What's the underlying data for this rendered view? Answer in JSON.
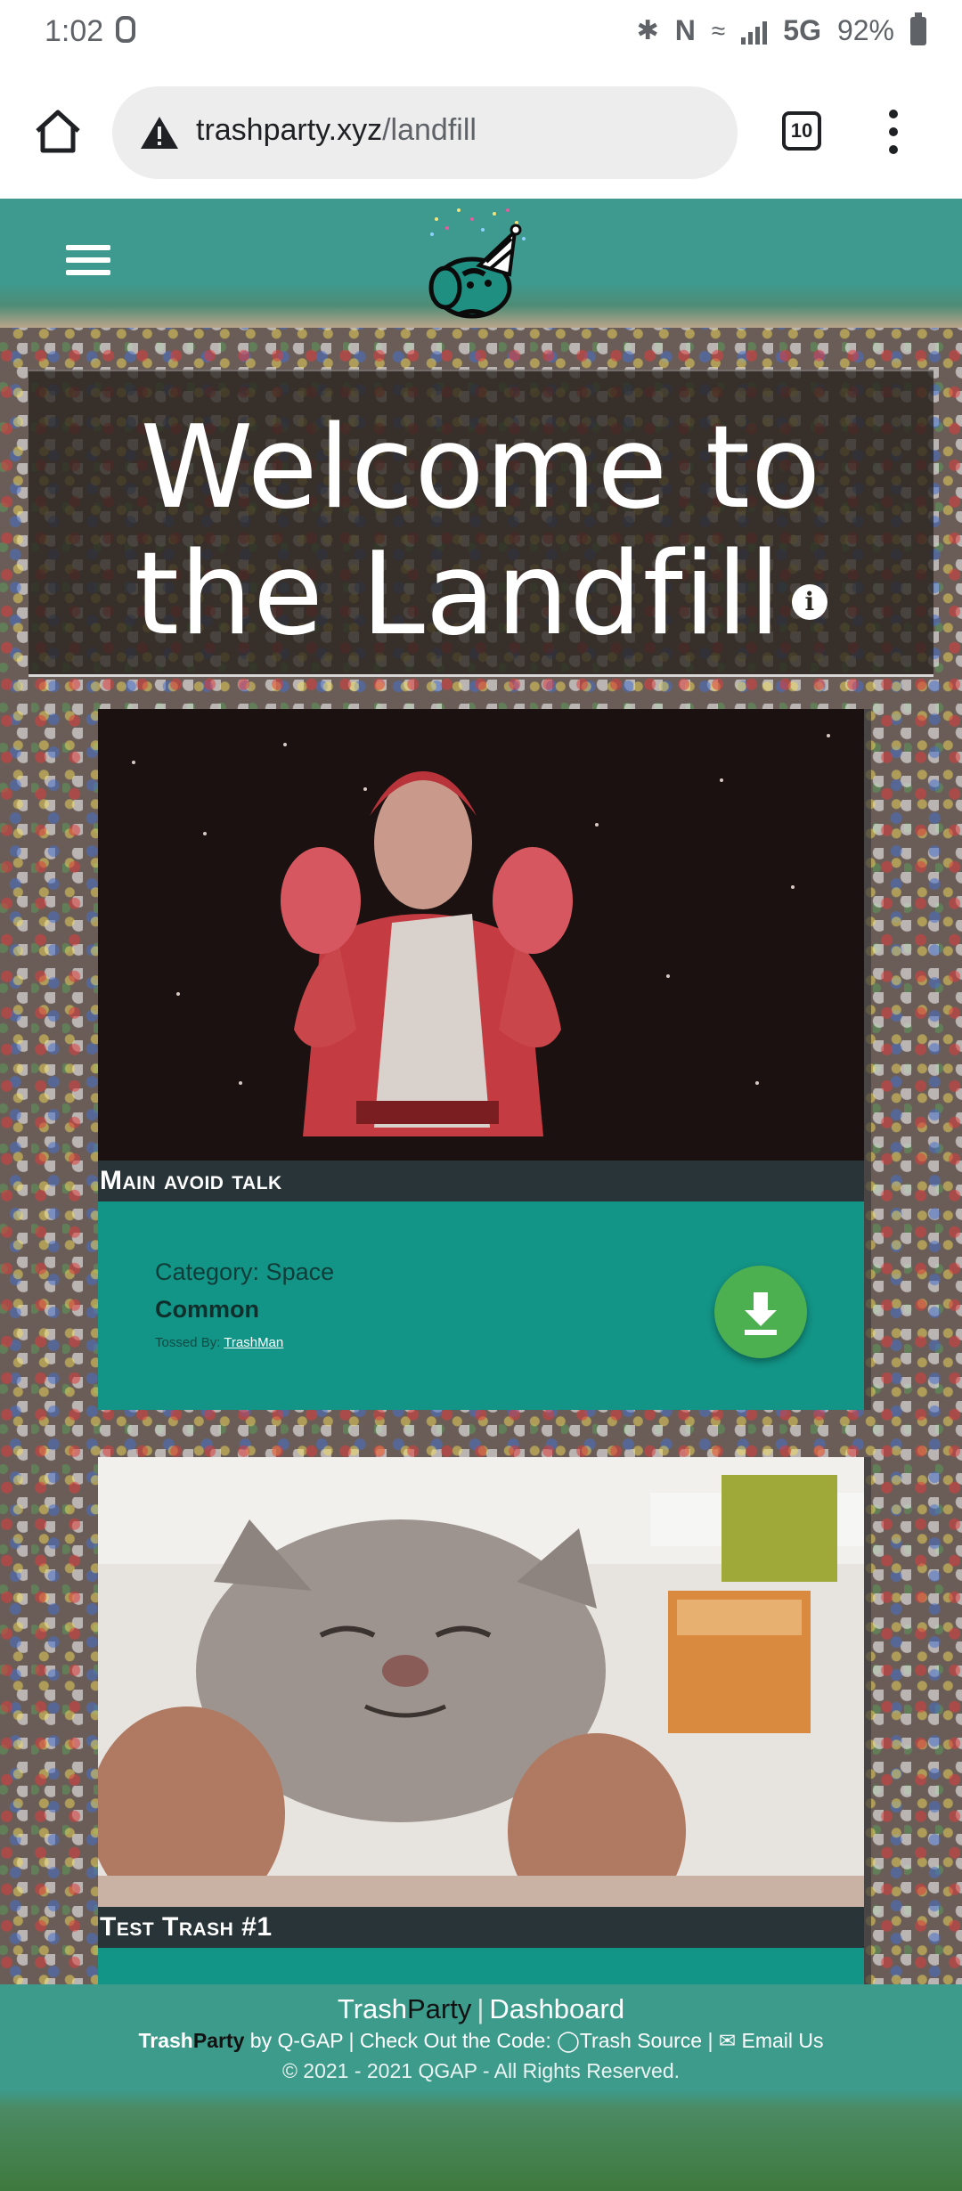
{
  "status_bar": {
    "time": "1:02",
    "network": "5G",
    "battery": "92%"
  },
  "browser": {
    "url_domain": "trashparty.xyz",
    "url_path": "/landfill",
    "tab_count": "10"
  },
  "hero": {
    "title": "Welcome to the Landfill",
    "info_icon": "info-icon"
  },
  "cards": [
    {
      "title": "Main avoid talk",
      "category": "Category: Space",
      "rarity": "Common",
      "tossed_by_label": "Tossed By:",
      "tossed_by_user": "TrashMan"
    },
    {
      "title": "Test Trash #1"
    }
  ],
  "footer": {
    "brand_trash": "Trash",
    "brand_party": "Party",
    "separator": "|",
    "dashboard": "Dashboard",
    "credit_by": "by Q-GAP | Check Out the Code:",
    "source_link": "Trash Source",
    "divider": "|",
    "email_link": "Email Us",
    "copyright": "© 2021 - 2021 QGAP - All Rights Reserved."
  },
  "colors": {
    "header_teal": "#3e9a8e",
    "card_body": "#129486",
    "card_title_bg": "#283438",
    "download_button": "#4caf50"
  }
}
